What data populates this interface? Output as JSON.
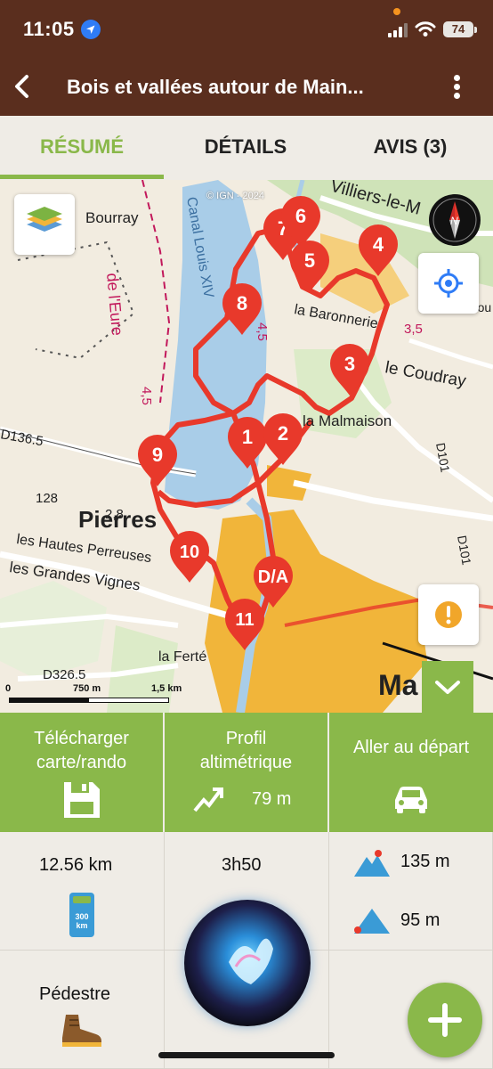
{
  "status_bar": {
    "time": "11:05",
    "battery": "74"
  },
  "header": {
    "title": "Bois et vallées autour de Main..."
  },
  "tabs": [
    {
      "label": "RÉSUMÉ",
      "active": true
    },
    {
      "label": "DÉTAILS",
      "active": false
    },
    {
      "label": "AVIS (3)",
      "active": false
    }
  ],
  "map": {
    "attribution": "© IGN - 2024",
    "scale": {
      "zero": "0",
      "mid": "750 m",
      "max": "1,5 km"
    },
    "markers": [
      "7",
      "6",
      "5",
      "4",
      "8",
      "3",
      "1",
      "2",
      "9",
      "10",
      "D/A",
      "11"
    ],
    "labels": {
      "bourray": "Bourray",
      "canal": "Canal Louis XIV",
      "eure": "de l'Eure",
      "villiers": "Villiers-le-M",
      "baronnerie": "la Baronnerie",
      "coudray": "le Coudray",
      "malmaison": "la Malmaison",
      "pierres": "Pierres",
      "hautes_perreuses": "les Hautes Perreuses",
      "grandes_vignes": "les Grandes Vignes",
      "ferte": "la Ferté",
      "ma": "Ma",
      "d136": "D136.5",
      "d326": "D326.5",
      "d101": "D101",
      "d101b": "D101",
      "n128": "128",
      "n28": "2,8",
      "n45a": "4,5",
      "n45b": "4,5",
      "n35": "3,5",
      "glancou": "Glancou"
    },
    "colors": {
      "route": "#e8392b",
      "water": "#a9cde8",
      "urban": "#f1b53a",
      "forest": "#cfe3b8"
    }
  },
  "actions": [
    {
      "label_line1": "Télécharger",
      "label_line2": "carte/rando",
      "icon": "save-icon"
    },
    {
      "label_line1": "Profil",
      "label_line2": "altimétrique",
      "value": "79 m",
      "icon": "elevation-chart-icon"
    },
    {
      "label_line1": "Aller au départ",
      "icon": "car-icon"
    }
  ],
  "stats": {
    "distance": "12.56 km",
    "duration": "3h50",
    "ascent": "135 m",
    "descent": "95 m",
    "practice": "Pédestre",
    "milestone_badge": "300 km"
  },
  "theme": {
    "brown": "#5a2e1e",
    "green": "#8ab84a"
  }
}
